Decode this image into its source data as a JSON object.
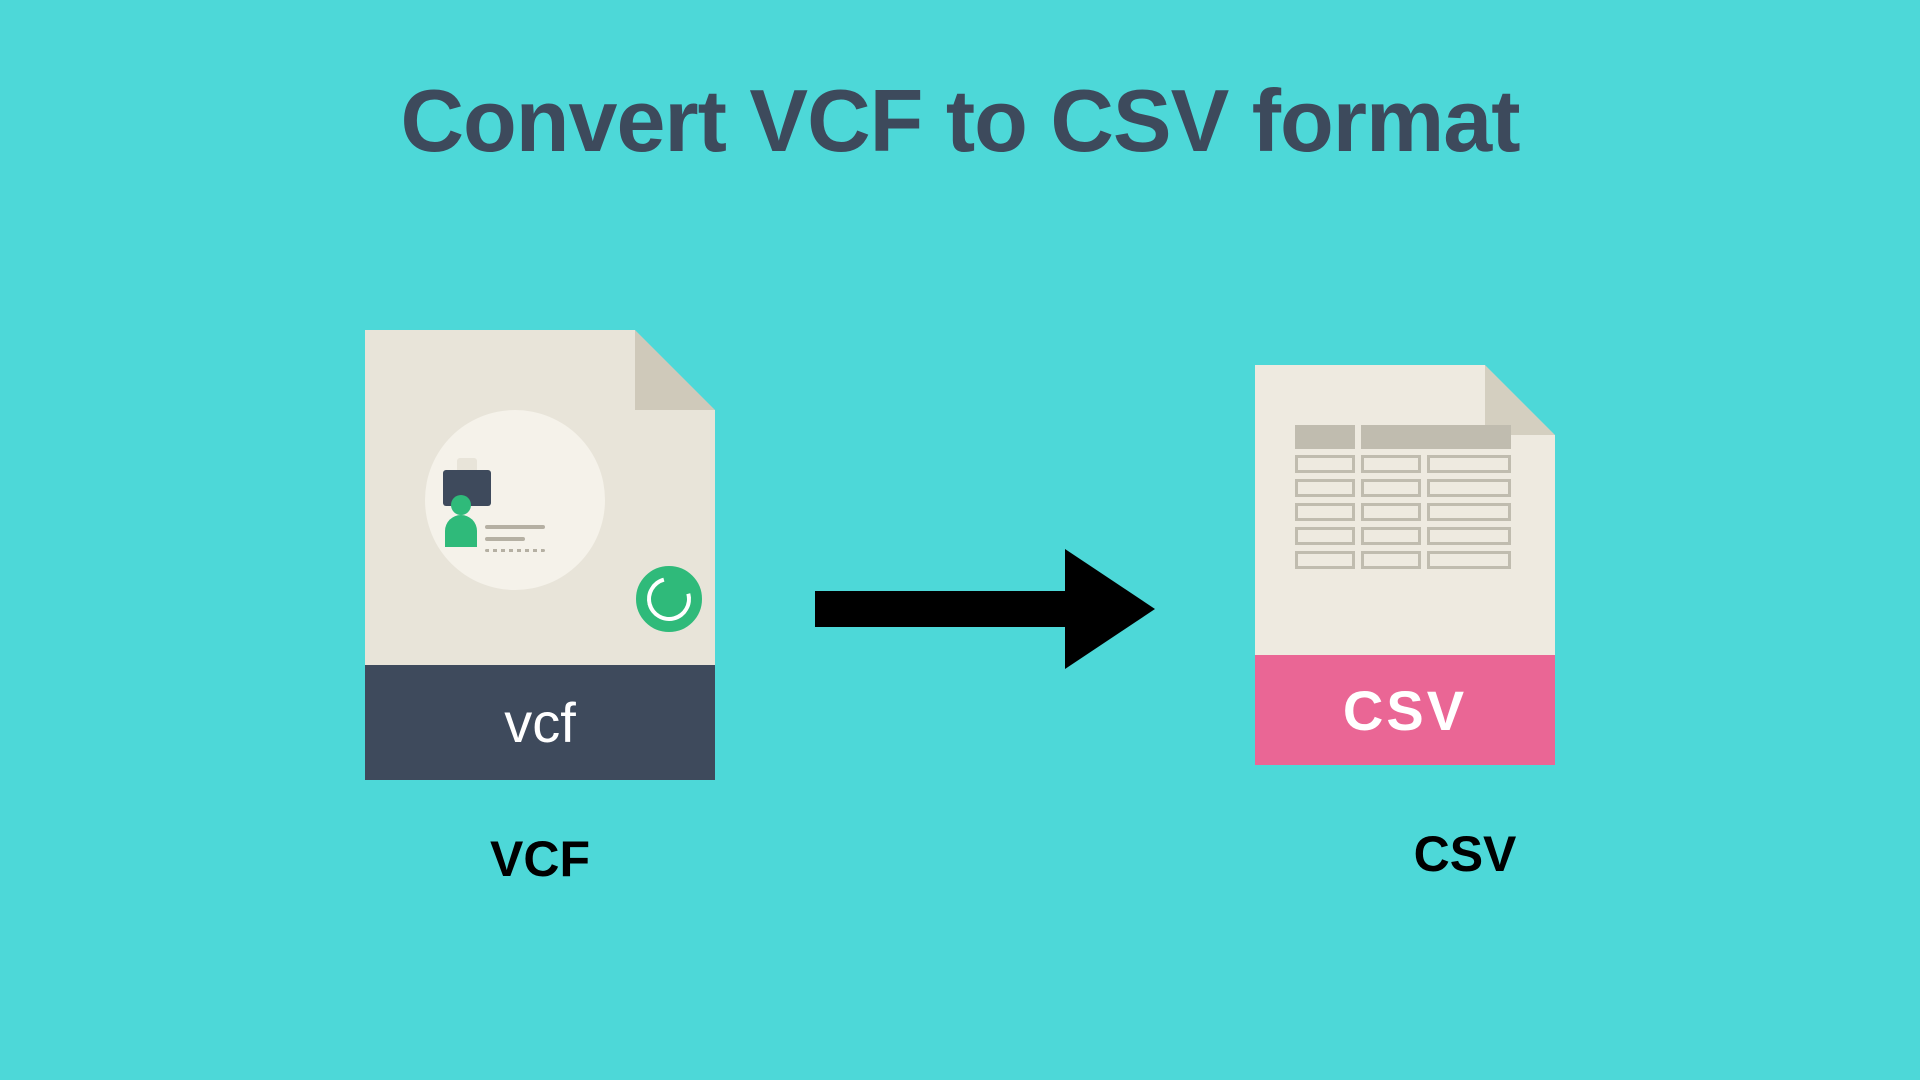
{
  "title": "Convert VCF to CSV format",
  "source": {
    "ext_label": "vcf",
    "caption": "VCF"
  },
  "target": {
    "ext_label": "CSV",
    "caption": "CSV"
  }
}
